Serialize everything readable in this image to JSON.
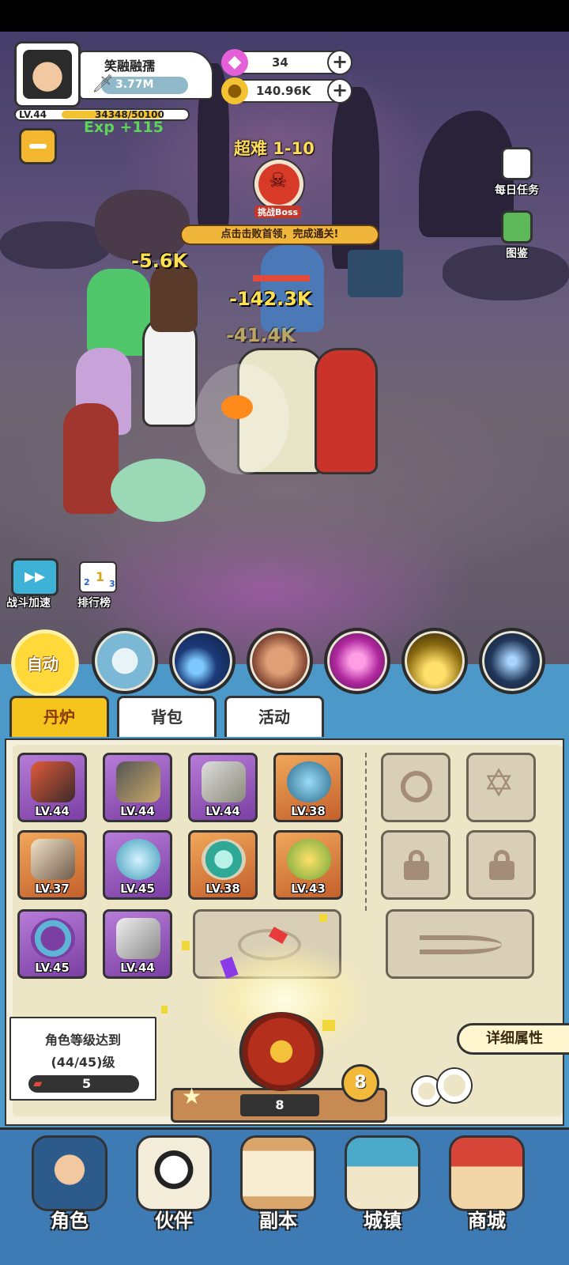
{
  "player": {
    "name": "笑融融孺",
    "power": "3.77M",
    "level": "LV.44",
    "exp": "34348/50100",
    "exp_gain": "Exp +115"
  },
  "resources": {
    "gems": "34",
    "gold": "140.96K"
  },
  "stage": {
    "title": "超难 1-10",
    "boss_label": "挑战Boss",
    "hint": "点击击败首领，完成通关!"
  },
  "side_buttons": {
    "daily_tasks": "每日任务",
    "codex": "图鉴",
    "battle_speed": "战斗加速",
    "leaderboard": "排行榜",
    "rank_digits": [
      "2",
      "1",
      "3"
    ]
  },
  "damage_numbers": [
    "-5.6K",
    "-142.3K",
    "-41.4K"
  ],
  "skills": {
    "auto": "自动"
  },
  "tabs": [
    "丹炉",
    "背包",
    "活动"
  ],
  "equipment": [
    {
      "level": "LV.44",
      "rarity": "purple",
      "item": "sword"
    },
    {
      "level": "LV.44",
      "rarity": "purple",
      "item": "helmet"
    },
    {
      "level": "LV.44",
      "rarity": "purple",
      "item": "robe"
    },
    {
      "level": "LV.38",
      "rarity": "orange",
      "item": "orb"
    },
    {
      "level": "LV.37",
      "rarity": "orange",
      "item": "crown"
    },
    {
      "level": "LV.45",
      "rarity": "purple",
      "item": "amulet"
    },
    {
      "level": "LV.38",
      "rarity": "orange",
      "item": "ring"
    },
    {
      "level": "LV.43",
      "rarity": "orange",
      "item": "gem"
    },
    {
      "level": "LV.45",
      "rarity": "purple",
      "item": "bracelet"
    },
    {
      "level": "LV.44",
      "rarity": "purple",
      "item": "boots"
    }
  ],
  "furnace": {
    "requirement_line1": "角色等级达到",
    "requirement_line2": "(44/45)级",
    "ticket_count": "5",
    "upgrade_level": "8",
    "count_label": "8",
    "detail_button": "详细属性"
  },
  "nav": [
    "角色",
    "伙伴",
    "副本",
    "城镇",
    "商城"
  ],
  "colors": {
    "tab_active": "#f5c51e",
    "panel_blue": "#4b98c9",
    "nav_blue": "#3e7bb4",
    "gear_purple": "#9a56c2",
    "gear_orange": "#e08a44"
  }
}
